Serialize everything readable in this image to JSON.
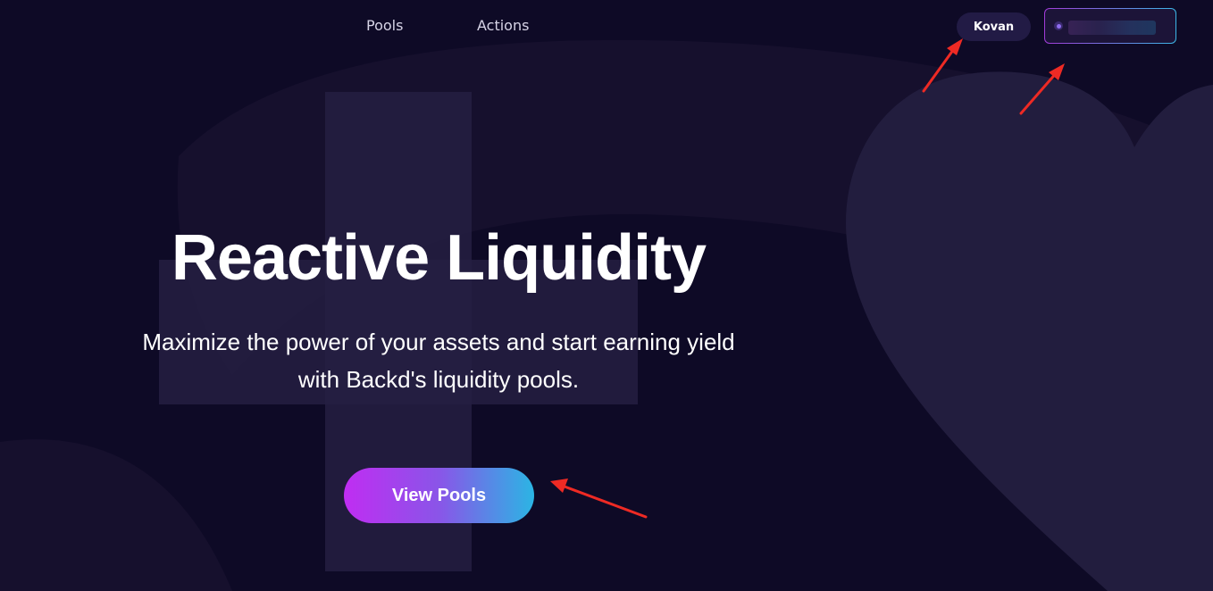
{
  "nav": {
    "links": [
      {
        "label": "Pools"
      },
      {
        "label": "Actions"
      }
    ],
    "network_badge": "Kovan",
    "wallet": {
      "status_color": "#8f6cf0",
      "address": ""
    }
  },
  "hero": {
    "title": "Reactive Liquidity",
    "subtitle_line1": "Maximize the power of your assets and start earning yield",
    "subtitle_line2": "with Backd's liquidity pools.",
    "cta_label": "View Pools"
  },
  "colors": {
    "background": "#0e0a26",
    "cta_gradient_start": "#c02df2",
    "cta_gradient_end": "#2bb5e4",
    "annotation_arrow": "#ee2a24"
  },
  "decorations": {
    "background_shapes": [
      "plus-shape",
      "heart-shape",
      "curved-band"
    ],
    "annotation_arrows": 3
  }
}
